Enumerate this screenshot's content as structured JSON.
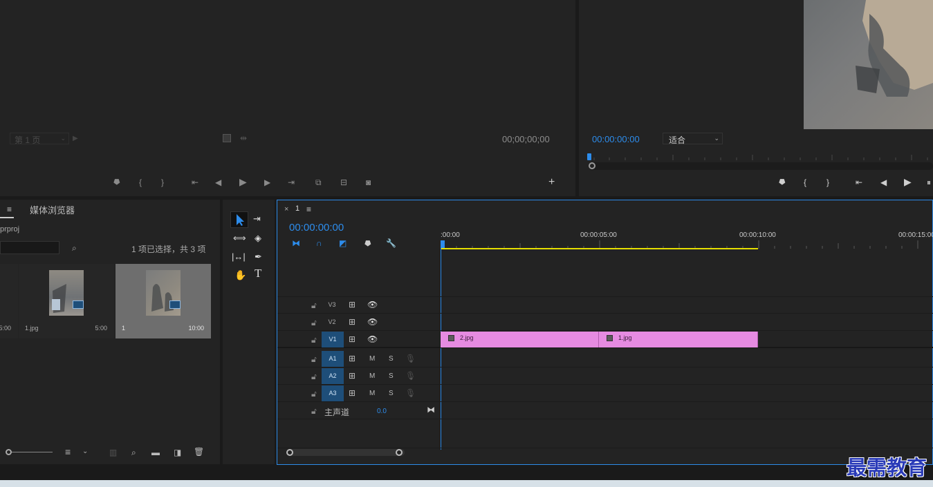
{
  "source_monitor": {
    "page_select": "第 1 页",
    "timecode": "00;00;00;00"
  },
  "program_monitor": {
    "timecode": "00:00:00:00",
    "fit": "适合"
  },
  "project": {
    "tab_label": "媒体浏览器",
    "project_file_suffix": "prproj",
    "selection_status": "1 项已选择，共 3 项",
    "items": [
      {
        "name": "",
        "duration": "5:00"
      },
      {
        "name": "1.jpg",
        "duration": "5:00"
      },
      {
        "name": "1",
        "duration": "10:00"
      }
    ]
  },
  "timeline": {
    "sequence_name": "1",
    "close": "×",
    "timecode": "00:00:00:00",
    "ruler": [
      ":00:00",
      "00:00:05:00",
      "00:00:10:00",
      "00:00:15:00"
    ],
    "video_tracks": [
      {
        "name": "V3"
      },
      {
        "name": "V2"
      },
      {
        "name": "V1"
      }
    ],
    "audio_tracks": [
      {
        "name": "A1",
        "m": "M",
        "s": "S"
      },
      {
        "name": "A2",
        "m": "M",
        "s": "S"
      },
      {
        "name": "A3",
        "m": "M",
        "s": "S"
      }
    ],
    "master": {
      "label": "主声道",
      "value": "0.0"
    },
    "clips": [
      {
        "name": "2.jpg"
      },
      {
        "name": "1.jpg"
      }
    ]
  },
  "watermark": "最需教育",
  "colors": {
    "accent": "#2d8ceb",
    "clip": "#e68be1",
    "track_active": "#1e4e79",
    "work_area": "#e7e000"
  }
}
